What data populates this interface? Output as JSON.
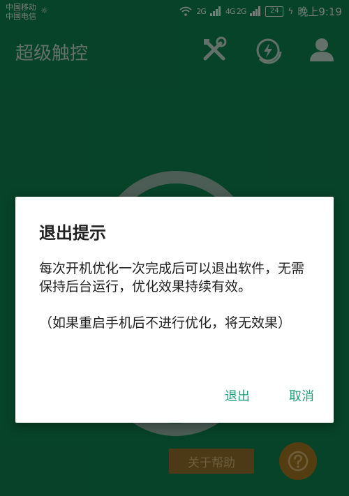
{
  "statusbar": {
    "carrier1": "中国移动",
    "carrier2": "中国电信",
    "sig1_tag": "2G",
    "sig2_tag": "4G 2G",
    "battery": "24",
    "time": "晚上9:19"
  },
  "appbar": {
    "title": "超级触控",
    "icons": [
      "tools-icon",
      "boost-icon",
      "user-icon"
    ]
  },
  "main": {
    "help_button": "关于帮助",
    "help_fab_icon": "question-icon"
  },
  "dialog": {
    "title": "退出提示",
    "message": "每次开机优化一次完成后可以退出软件，无需保持后台运行，优化效果持续有效。\n\n（如果重启手机后不进行优化，将无效果）",
    "exit_label": "退出",
    "cancel_label": "取消"
  },
  "colors": {
    "app_bg": "#0e7a4a",
    "accent": "#1ea07a",
    "help_button": "#8a6a2b"
  }
}
